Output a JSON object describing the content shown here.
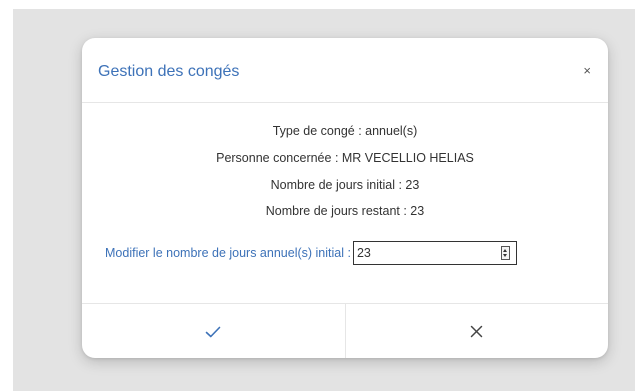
{
  "dialog": {
    "title": "Gestion des congés",
    "close_label": "×",
    "info": {
      "type": "Type de congé : annuel(s)",
      "person": "Personne concernée : MR VECELLIO HELIAS",
      "initial_days": "Nombre de jours initial : 23",
      "remaining_days": "Nombre de jours restant : 23"
    },
    "edit": {
      "label": "Modifier le nombre de jours annuel(s) initial :",
      "value": "23"
    },
    "actions": {
      "confirm_icon": "check-icon",
      "cancel_icon": "x-icon"
    }
  },
  "colors": {
    "accent": "#3d72b8",
    "text": "#333333",
    "backdrop": "#e3e3e3",
    "divider": "#e6e6e6"
  }
}
